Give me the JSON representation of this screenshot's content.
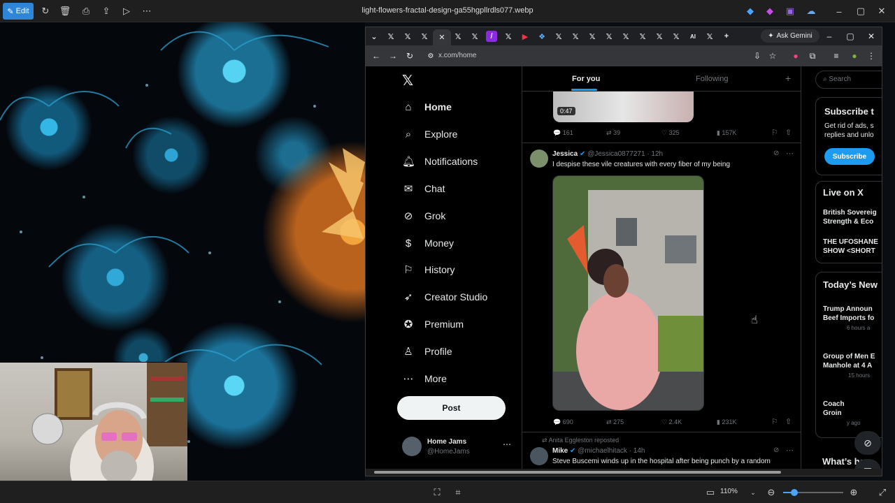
{
  "viewer": {
    "edit_label": "Edit",
    "filename": "light-flowers-fractal-design-ga55hgpllrdls077.webp",
    "zoom": "110%"
  },
  "browser": {
    "url": "x.com/home",
    "ask_gemini": "Ask Gemini"
  },
  "x": {
    "nav": [
      {
        "label": "Home",
        "icon": "home-icon"
      },
      {
        "label": "Explore",
        "icon": "search-icon"
      },
      {
        "label": "Notifications",
        "icon": "bell-icon"
      },
      {
        "label": "Chat",
        "icon": "chat-icon"
      },
      {
        "label": "Grok",
        "icon": "grok-icon"
      },
      {
        "label": "Money",
        "icon": "money-icon"
      },
      {
        "label": "History",
        "icon": "bookmark-icon"
      },
      {
        "label": "Creator Studio",
        "icon": "rocket-icon"
      },
      {
        "label": "Premium",
        "icon": "premium-icon"
      },
      {
        "label": "Profile",
        "icon": "person-icon"
      },
      {
        "label": "More",
        "icon": "more-circle-icon"
      }
    ],
    "post_label": "Post",
    "account": {
      "name": "Home Jams",
      "handle": "@HomeJams"
    },
    "tabs": {
      "for_you": "For you",
      "following": "Following"
    },
    "prev_post": {
      "duration": "0:47",
      "replies": "161",
      "reposts": "39",
      "likes": "325",
      "views": "157K"
    },
    "post1": {
      "name": "Jessica",
      "handle": "@Jessica0877271",
      "time": "· 12h",
      "text": "I despise these vile creatures with every fiber of my being",
      "replies": "690",
      "reposts": "275",
      "likes": "2.4K",
      "views": "231K"
    },
    "post2": {
      "reposted_by": "Anita Eggleston reposted",
      "name": "Mike",
      "handle": "@michaelhitack",
      "time": "· 14h",
      "text": "Steve Buscemi winds up in the hospital after being punch by a random"
    },
    "right": {
      "search_placeholder": "Search",
      "subscribe_title": "Subscribe t",
      "subscribe_text": "Get rid of ads, s replies and unlo",
      "subscribe_btn": "Subscribe",
      "live_title": "Live on X",
      "live1": "British Sovereig\nStrength & Eco",
      "live2": "THE UFOSHANE\nSHOW <SHORT",
      "news_title": "Today’s New",
      "news1": "Trump Announ\nBeef Imports fo",
      "news1_time": "6 hours a",
      "news2": "Group of Men E\nManhole at 4 A",
      "news2_time": "15 hours",
      "news3": "Coach\nGroin",
      "news3_time": "y ago",
      "whats_happening": "What’s hap"
    }
  }
}
